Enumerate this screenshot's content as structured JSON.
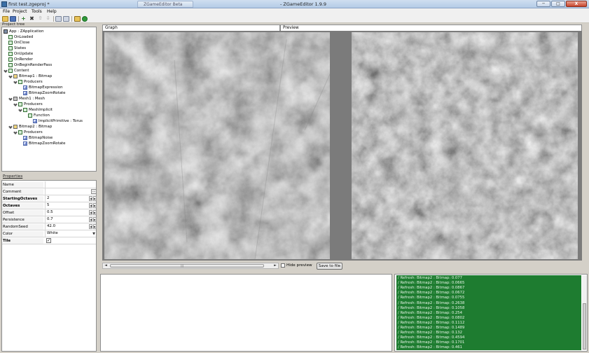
{
  "window": {
    "doc_title": "first test.zgeproj *",
    "app_title": "- ZGameEditor 1.9.9",
    "ghost_tab": "ZGameEditor Beta",
    "min_label": "─",
    "max_label": "□",
    "close_label": "X"
  },
  "menu": [
    "File",
    "Project",
    "Tools",
    "Help"
  ],
  "toolbar": {
    "icons": [
      "open-icon",
      "save-icon",
      "add-icon",
      "delete-icon",
      "move-up-icon",
      "move-down-icon",
      "copy-icon",
      "paste-icon",
      "lock-icon",
      "run-icon"
    ]
  },
  "tree": {
    "caption": "Project tree",
    "items": [
      {
        "label": "App : ZApplication",
        "icon": "app",
        "level": 0
      },
      {
        "label": "OnLoaded",
        "icon": "node",
        "level": 1
      },
      {
        "label": "OnClose",
        "icon": "node",
        "level": 1
      },
      {
        "label": "States",
        "icon": "node",
        "level": 1
      },
      {
        "label": "OnUpdate",
        "icon": "node",
        "level": 1
      },
      {
        "label": "OnRender",
        "icon": "node",
        "level": 1
      },
      {
        "label": "OnBeginRenderPass",
        "icon": "node",
        "level": 1
      },
      {
        "label": "Content",
        "icon": "node",
        "level": 1
      },
      {
        "label": "Bitmap1 : Bitmap",
        "icon": "folder",
        "level": 2
      },
      {
        "label": "Producers",
        "icon": "node",
        "level": 3
      },
      {
        "label": "BitmapExpression",
        "icon": "bitmap",
        "level": 4
      },
      {
        "label": "BitmapZoomRotate",
        "icon": "bitmap",
        "level": 4
      },
      {
        "label": "Mesh1 : Mesh",
        "icon": "mesh",
        "level": 2
      },
      {
        "label": "Producers",
        "icon": "node",
        "level": 3
      },
      {
        "label": "MeshImplicit",
        "icon": "node",
        "level": 4
      },
      {
        "label": "Function",
        "icon": "node",
        "level": 5
      },
      {
        "label": "ImplicitPrimitive : Torus",
        "icon": "bitmap",
        "level": 6
      },
      {
        "label": "Bitmap2 : Bitmap",
        "icon": "folder",
        "level": 2
      },
      {
        "label": "Producers",
        "icon": "node",
        "level": 3
      },
      {
        "label": "BitmapNoise",
        "icon": "bitmap",
        "level": 4
      },
      {
        "label": "BitmapZoomRotate",
        "icon": "bitmap",
        "level": 4
      }
    ]
  },
  "properties": {
    "caption": "Properties",
    "rows": [
      {
        "name": "Name",
        "value": "",
        "kind": "text",
        "bold": false
      },
      {
        "name": "Comment",
        "value": "",
        "kind": "dots",
        "bold": false
      },
      {
        "name": "StartingOctaves",
        "value": "2",
        "kind": "spin",
        "bold": true
      },
      {
        "name": "Octaves",
        "value": "5",
        "kind": "spin",
        "bold": true
      },
      {
        "name": "Offset",
        "value": "0.5",
        "kind": "spin",
        "bold": false
      },
      {
        "name": "Persistence",
        "value": "0.7",
        "kind": "spin",
        "bold": false
      },
      {
        "name": "RandomSeed",
        "value": "42.0",
        "kind": "spin",
        "bold": false
      },
      {
        "name": "Color",
        "value": "White",
        "kind": "combo",
        "bold": false
      },
      {
        "name": "Tile",
        "value": "✓",
        "kind": "check",
        "bold": true
      }
    ]
  },
  "views": {
    "graph_tab": "Graph",
    "preview_tab": "Preview",
    "hide_preview_label": "Hide preview",
    "save_button_label": "Save to file",
    "scroll_left": "◄",
    "scroll_right": "►",
    "scroll_grip": "|||"
  },
  "log": {
    "lines": [
      "Refresh: Bitmap2 : Bitmap: 0.077",
      "Refresh: Bitmap2 : Bitmap: 0.0665",
      "Refresh: Bitmap2 : Bitmap: 0.0867",
      "Refresh: Bitmap2 : Bitmap: 0.0672",
      "Refresh: Bitmap2 : Bitmap: 0.0755",
      "Refresh: Bitmap2 : Bitmap: 0.2638",
      "Refresh: Bitmap2 : Bitmap: 0.1058",
      "Refresh: Bitmap2 : Bitmap: 0.254",
      "Refresh: Bitmap2 : Bitmap: 0.0802",
      "Refresh: Bitmap2 : Bitmap: 0.1112",
      "Refresh: Bitmap2 : Bitmap: 0.1489",
      "Refresh: Bitmap2 : Bitmap: 0.132",
      "Refresh: Bitmap2 : Bitmap: 0.4594",
      "Refresh: Bitmap2 : Bitmap: 0.1701",
      "Refresh: Bitmap2 : Bitmap: 0.461"
    ]
  },
  "colors": {
    "log_background": "#1e7c30",
    "log_text": "#e6f4e6",
    "viewport_background": "#7b7b7b"
  }
}
